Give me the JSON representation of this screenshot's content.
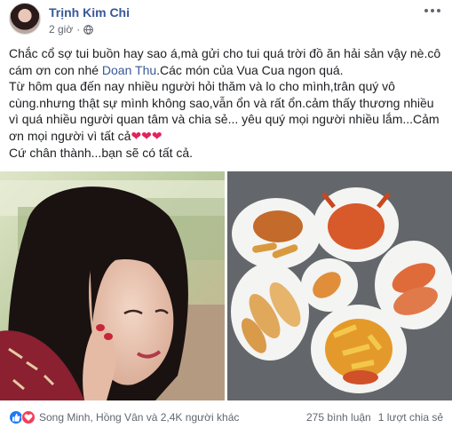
{
  "post": {
    "author": "Trịnh Kim Chi",
    "time": "2 giờ",
    "privacy_icon": "globe-icon",
    "text": {
      "line1_before_mention": "Chắc cổ sợ tui buồn hay sao á,mà gửi cho tui quá trời đồ ăn hải sản vậy nè.cô cám ơn con nhé ",
      "mention": "Doan Thu",
      "line1_after_mention": ".Các món của Vua Cua ngon quá.",
      "paragraph2": "Từ hôm qua đến nay nhiều người hỏi thăm và lo cho mình,trân quý vô cùng.nhưng thật sự mình không sao,vẫn ổn và rất ổn.cảm thấy thương nhiều vì quá nhiều người quan tâm và chia sẻ... yêu quý mọi người nhiều lắm...Cảm ơn mọi người vì tất cả",
      "hearts": "❤❤❤",
      "paragraph3": "Cứ chân thành...bạn sẽ có tất cả."
    }
  },
  "footer": {
    "reaction_icons": [
      "like-icon",
      "love-icon"
    ],
    "reaction_names": "Song Minh, Hồng Vân và 2,4K người khác",
    "comments": "275 bình luận",
    "shares": "1 lượt chia sẻ"
  },
  "colors": {
    "author_link": "#385898",
    "like_blue": "#2078f4",
    "love_red": "#f33e58",
    "heart_red": "#e0245e"
  }
}
